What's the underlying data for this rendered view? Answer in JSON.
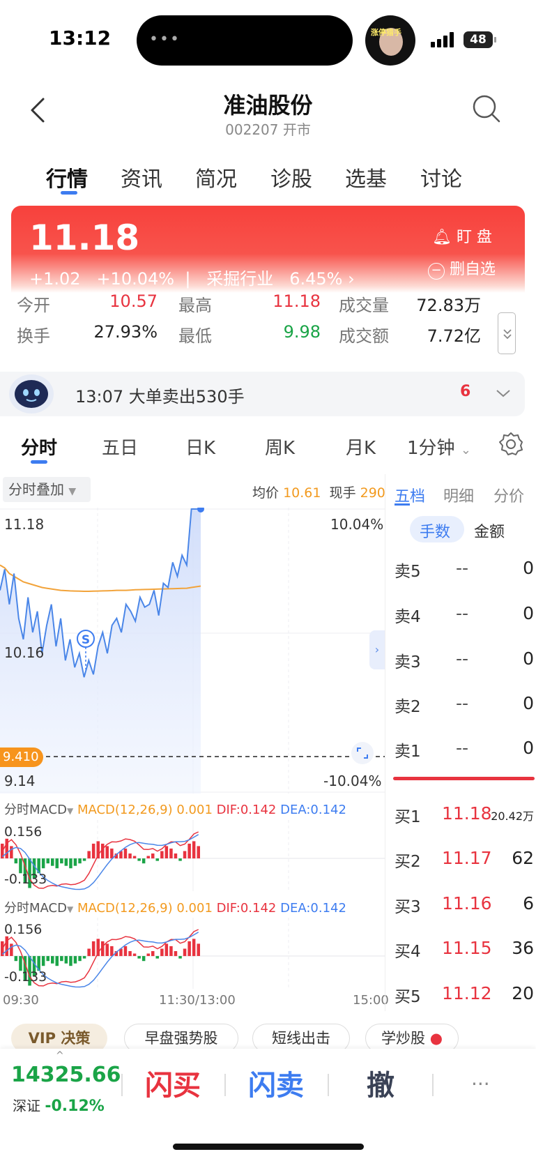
{
  "status": {
    "time": "13:12",
    "battery": "48",
    "avatar_text": "涨停猎手"
  },
  "header": {
    "name": "准油股份",
    "code_status": "002207 开市"
  },
  "tabs": [
    "行情",
    "资讯",
    "简况",
    "诊股",
    "选基",
    "讨论"
  ],
  "quote": {
    "price": "11.18",
    "change": "+1.02",
    "change_pct": "+10.04%",
    "industry": "采掘行业",
    "industry_pct": "6.45%",
    "watch_label": "盯  盘",
    "remove_label": "删自选"
  },
  "stats": [
    {
      "label": "今开",
      "value": "10.57"
    },
    {
      "label": "最高",
      "value": "11.18"
    },
    {
      "label": "成交量",
      "value": "72.83万"
    },
    {
      "label": "换手",
      "value": "27.93%"
    },
    {
      "label": "最低",
      "value": "9.98"
    },
    {
      "label": "成交额",
      "value": "7.72亿"
    }
  ],
  "alert": {
    "text": "13:07 大单卖出530手",
    "count": "6"
  },
  "chart_tabs": [
    "分时",
    "五日",
    "日K",
    "周K",
    "月K",
    "1分钟"
  ],
  "chart_header": {
    "overlay": "分时叠加",
    "avg_label": "均价",
    "avg_value": "10.61",
    "vol_label": "现手",
    "vol_value": "290"
  },
  "chart_data": [
    {
      "type": "line",
      "title": "",
      "y_labels": {
        "top": "11.18",
        "mid": "10.16",
        "bottom": "9.14"
      },
      "pct_labels": {
        "top": "10.04%",
        "bottom": "-10.04%"
      },
      "prev_close_tag": "9.410",
      "x_labels": [
        "09:30",
        "11:30/13:00",
        "15:00"
      ],
      "ylim": [
        9.14,
        11.18
      ],
      "series": [
        {
          "name": "",
          "color": "#4a86e8",
          "values": [
            10.6,
            10.75,
            10.5,
            10.72,
            10.4,
            10.25,
            10.55,
            10.3,
            10.45,
            10.15,
            10.35,
            10.5,
            10.2,
            10.4,
            10.1,
            10.25,
            10.05,
            10.15,
            9.98,
            10.1,
            10.0,
            10.2,
            10.3,
            10.15,
            10.35,
            10.4,
            10.3,
            10.5,
            10.45,
            10.38,
            10.55,
            10.48,
            10.5,
            10.6,
            10.42,
            10.65,
            10.62,
            10.8,
            10.7,
            10.85,
            10.78,
            11.18,
            11.18,
            11.18
          ]
        },
        {
          "name": "",
          "color": "#f2a33a",
          "values": [
            10.78,
            10.76,
            10.72,
            10.7,
            10.68,
            10.66,
            10.65,
            10.64,
            10.63,
            10.62,
            10.615,
            10.61,
            10.605,
            10.6,
            10.598,
            10.596,
            10.595,
            10.594,
            10.593,
            10.593,
            10.594,
            10.595,
            10.596,
            10.597,
            10.598,
            10.6,
            10.6,
            10.6,
            10.602,
            10.604,
            10.605,
            10.606,
            10.607,
            10.608,
            10.609,
            10.61,
            10.611,
            10.612,
            10.613,
            10.614,
            10.615,
            10.62,
            10.625,
            10.63
          ]
        }
      ]
    },
    {
      "type": "bar",
      "title": "分时MACD",
      "legend": "MACD(12,26,9) 0.001",
      "dif": "DIF:0.142",
      "dea": "DEA:0.142",
      "y_labels": {
        "top": "0.156",
        "bottom": "-0.133"
      },
      "ylim": [
        -0.133,
        0.156
      ],
      "values": [
        0.06,
        0.08,
        0.05,
        -0.02,
        -0.06,
        -0.1,
        -0.12,
        -0.08,
        -0.06,
        -0.04,
        -0.02,
        -0.03,
        -0.04,
        -0.02,
        -0.03,
        -0.04,
        -0.03,
        -0.02,
        -0.01,
        0.03,
        0.06,
        0.07,
        0.06,
        0.05,
        0.04,
        0.02,
        0.03,
        0.04,
        0.02,
        0.01,
        -0.01,
        -0.02,
        0.01,
        0.02,
        -0.01,
        0.03,
        0.05,
        0.04,
        0.02,
        -0.01,
        0.03,
        0.06,
        0.07,
        0.05
      ]
    },
    {
      "type": "bar",
      "title": "分时MACD",
      "legend": "MACD(12,26,9) 0.001",
      "dif": "DIF:0.142",
      "dea": "DEA:0.142",
      "y_labels": {
        "top": "0.156",
        "bottom": "-0.133"
      },
      "ylim": [
        -0.133,
        0.156
      ],
      "values": [
        0.06,
        0.08,
        0.05,
        -0.02,
        -0.06,
        -0.1,
        -0.12,
        -0.08,
        -0.06,
        -0.04,
        -0.02,
        -0.03,
        -0.04,
        -0.02,
        -0.03,
        -0.04,
        -0.03,
        -0.02,
        -0.01,
        0.03,
        0.06,
        0.07,
        0.06,
        0.05,
        0.04,
        0.02,
        0.03,
        0.04,
        0.02,
        0.01,
        -0.01,
        -0.02,
        0.01,
        0.02,
        -0.01,
        0.03,
        0.05,
        0.04,
        0.02,
        -0.01,
        0.03,
        0.06,
        0.07,
        0.05
      ]
    }
  ],
  "right_panel": {
    "tabs": [
      "五档",
      "明细",
      "分价"
    ],
    "unit_tabs": [
      "手数",
      "金额"
    ],
    "asks": [
      {
        "label": "卖5",
        "price": "--",
        "qty": "0"
      },
      {
        "label": "卖4",
        "price": "--",
        "qty": "0"
      },
      {
        "label": "卖3",
        "price": "--",
        "qty": "0"
      },
      {
        "label": "卖2",
        "price": "--",
        "qty": "0"
      },
      {
        "label": "卖1",
        "price": "--",
        "qty": "0"
      }
    ],
    "bids": [
      {
        "label": "买1",
        "price": "11.18",
        "qty": "20.42万"
      },
      {
        "label": "买2",
        "price": "11.17",
        "qty": "62"
      },
      {
        "label": "买3",
        "price": "11.16",
        "qty": "6"
      },
      {
        "label": "买4",
        "price": "11.15",
        "qty": "36"
      },
      {
        "label": "买5",
        "price": "11.12",
        "qty": "20"
      }
    ]
  },
  "chips": {
    "vip": "VIP 决策",
    "items": [
      "早盘强势股",
      "短线出击",
      "学炒股"
    ]
  },
  "bottom": {
    "index_value": "14325.66",
    "index_name": "深证",
    "index_change": "-0.12%",
    "buy": "闪买",
    "sell": "闪卖",
    "cancel": "撤",
    "more": "···"
  },
  "colors": {
    "up": "#e8333f",
    "down": "#1aa447",
    "accent": "#3d7cf0",
    "avg_line": "#f2a33a"
  }
}
